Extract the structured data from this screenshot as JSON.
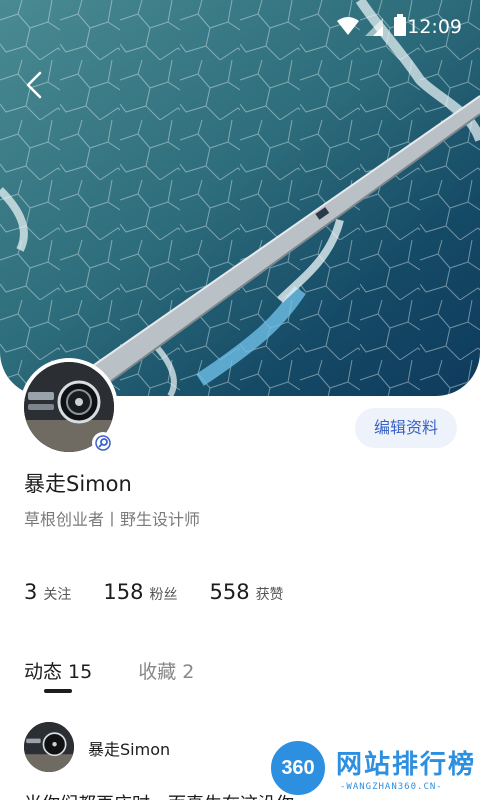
{
  "status_bar": {
    "time": "12:09",
    "wifi_icon": "wifi-icon",
    "signal_icon": "signal-icon",
    "battery_icon": "battery-icon"
  },
  "header": {
    "back_icon": "chevron-left-icon"
  },
  "profile": {
    "name": "暴走Simon",
    "bio": "草根创业者丨野生设计师",
    "edit_label": "编辑资料",
    "badge_icon": "verified-icon"
  },
  "stats": [
    {
      "value": "3",
      "label": "关注"
    },
    {
      "value": "158",
      "label": "粉丝"
    },
    {
      "value": "558",
      "label": "获赞"
    }
  ],
  "tabs": [
    {
      "label": "动态",
      "count": "15",
      "active": true
    },
    {
      "label": "收藏",
      "count": "2",
      "active": false
    }
  ],
  "post": {
    "author": "暴走Simon",
    "text": "当你们都再床时，而真生在这没你"
  },
  "watermark": {
    "badge": "360",
    "title": "网站排行榜",
    "subtitle": "-WANGZHAN360.CN-"
  },
  "colors": {
    "accent": "#3a63c8",
    "button_bg": "#eef2fb",
    "watermark": "#2d8fe0"
  }
}
